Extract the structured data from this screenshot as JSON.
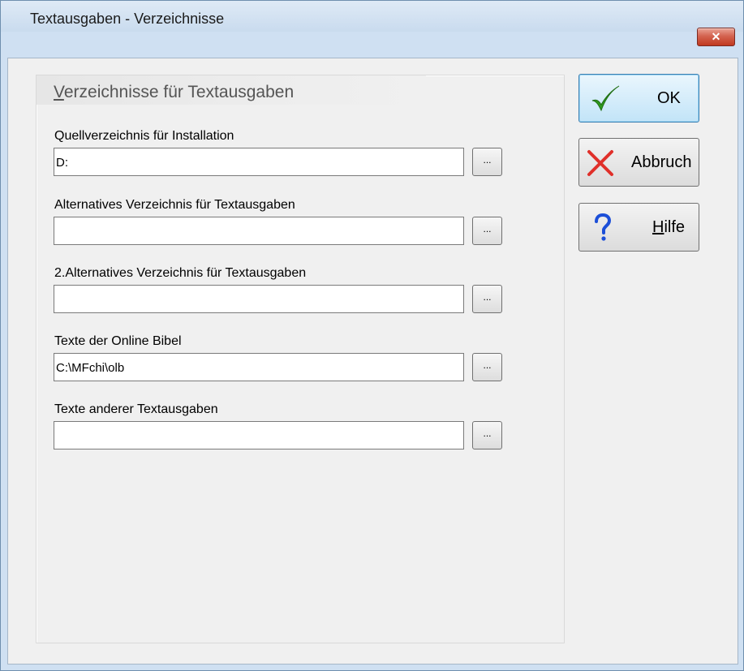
{
  "window": {
    "title": "Textausgaben - Verzeichnisse",
    "close_label": "✕"
  },
  "group": {
    "title": "Verzeichnisse für Textausgaben",
    "title_accel_char": "V",
    "title_rest": "erzeichnisse für Textausgaben"
  },
  "fields": [
    {
      "label": "Quellverzeichnis für Installation",
      "value": "D:",
      "browse_label": "..."
    },
    {
      "label": "Alternatives Verzeichnis für Textausgaben",
      "value": "",
      "browse_label": "..."
    },
    {
      "label": "2.Alternatives Verzeichnis für Textausgaben",
      "value": "",
      "browse_label": "..."
    },
    {
      "label": "Texte der Online Bibel",
      "value": "C:\\MFchi\\olb",
      "browse_label": "..."
    },
    {
      "label": "Texte anderer Textausgaben",
      "value": "",
      "browse_label": "..."
    }
  ],
  "buttons": {
    "ok": {
      "label": "OK",
      "icon": "checkmark-icon",
      "icon_color": "#2e9a1e"
    },
    "cancel": {
      "label": "Abbruch",
      "icon": "cancel-x-icon",
      "icon_color": "#e0302a"
    },
    "help": {
      "label": "Hilfe",
      "accel_char": "H",
      "rest": "ilfe",
      "icon": "question-icon",
      "icon_color": "#1c4fd8"
    }
  }
}
